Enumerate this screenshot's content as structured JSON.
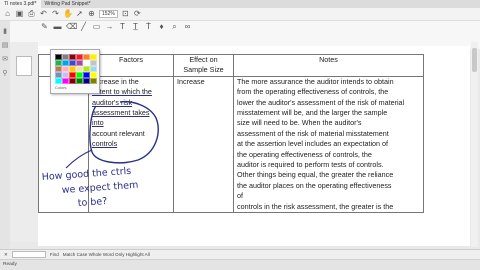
{
  "tabs": [
    {
      "label": "TI notes 3.pdf*",
      "active": true
    },
    {
      "label": "Writing Pad Snippet*",
      "active": false
    }
  ],
  "toolbar": {
    "zoom_value": "152%"
  },
  "table": {
    "headers": [
      "Factors",
      "Effect on Sample Size",
      "Notes"
    ],
    "factors_lines": [
      "increase in the",
      "extent to which the",
      "auditor's risk",
      "assessment takes",
      "into",
      "account relevant",
      "controls"
    ],
    "effect": "Increase",
    "notes_lines": [
      "The more assurance the auditor intends to obtain",
      "from the operating effectiveness of controls, the",
      "lower the auditor's assessment of the risk of material",
      "misstatement will be, and the larger the sample",
      "size will need to be. When the auditor's",
      "assessment of the risk of material misstatement",
      "at the assertion level includes an expectation of",
      "the operating effectiveness of controls, the",
      "auditor is required to perform tests of controls.",
      "Other things being equal, the greater the reliance",
      "the auditor places on the operating effectiveness",
      "of",
      "controls in the risk assessment, the greater is the"
    ]
  },
  "color_popup": {
    "label": "Colors",
    "swatches": [
      "#000000",
      "#7f7f7f",
      "#880015",
      "#ed1c24",
      "#ff7f27",
      "#fff200",
      "#22b14c",
      "#00a2e8",
      "#3f48cc",
      "#a349a4",
      "#ffffff",
      "#c3c3c3",
      "#b97a57",
      "#ffaec9",
      "#ffc90e",
      "#efe4b0",
      "#b5e61d",
      "#99d9ea",
      "#7092be",
      "#c8bfe7",
      "#ff0000",
      "#00ff00",
      "#0000ff",
      "#ffff00",
      "#00ffff",
      "#ff00ff",
      "#800000",
      "#008000",
      "#000080",
      "#808000"
    ]
  },
  "handwriting": {
    "lines": [
      "How good the ctrls",
      "we expect them",
      "to be?"
    ],
    "color": "#2a2e8c"
  },
  "findbar": {
    "label": "Find",
    "options": "Match Case  Whole Word Only  Highlight All"
  },
  "statusbar": {
    "text": "Ready"
  }
}
